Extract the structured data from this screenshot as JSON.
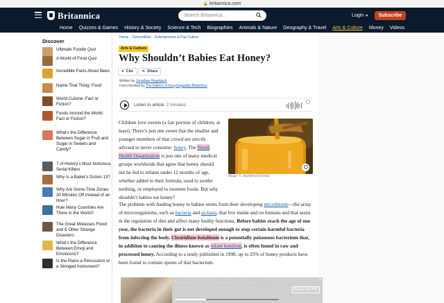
{
  "browser": {
    "url": "britannica.com"
  },
  "header": {
    "logo_text": "Britannica",
    "search_placeholder": "Search Britannica...",
    "login_label": "Login",
    "subscribe_label": "Subscribe"
  },
  "nav": {
    "items": [
      "Home",
      "Quizzes & Games",
      "History & Society",
      "Science & Tech",
      "Biographies",
      "Animals & Nature",
      "Geography & Travel",
      "Arts & Culture",
      "Money",
      "Videos"
    ],
    "active": "Arts & Culture"
  },
  "discover": {
    "title": "Discover",
    "items": [
      {
        "label": "Ultimate Foodie Quiz",
        "thumb": "#c8a06a"
      },
      {
        "label": "A World of Food Quiz",
        "thumb": "#9a6a3a"
      },
      {
        "label": "Incredible Facts About Bees",
        "thumb": "#d9a531"
      },
      {
        "label": "Name That Thing: Food",
        "thumb": "#c98a4e"
      },
      {
        "label": "World Cuisine: Fact or Fiction?",
        "thumb": "#7a4e2c"
      },
      {
        "label": "Foods Around the World: Fact or Fiction?",
        "thumb": "#b05a2a"
      },
      {
        "label": "What's the Difference Between Sugar in Fruit and Sugar in Sweets and Candy?",
        "thumb": "#d87a5a"
      },
      {
        "label": "7 of History's Most Notorious Serial Killers",
        "thumb": "#5a5a5a"
      },
      {
        "label": "Why Is a Baker's Dozen 13?",
        "thumb": "#a86d3c"
      },
      {
        "label": "Why Are Some Time Zones 30 Minutes Off Instead of an Hour?",
        "thumb": "#4a7ab0"
      },
      {
        "label": "How Many Countries Are There in the World?",
        "thumb": "#3f6f9a"
      },
      {
        "label": "The Great Molasses Flood and 6 Other Strange Disasters",
        "thumb": "#6b5a4a"
      },
      {
        "label": "What's the Difference Between Emoji and Emoticons?",
        "thumb": "#e0b84a"
      },
      {
        "label": "Is the Piano a Percussion or a Stringed Instrument?",
        "thumb": "#2f2f2f"
      }
    ]
  },
  "article": {
    "breadcrumb": [
      "Home",
      "Demystified",
      "Entertainment & Pop Culture"
    ],
    "tag": "Arts & Culture",
    "title": "Why Shouldn’t Babies Eat Honey?",
    "cite_label": "Cite",
    "share_label": "Share",
    "written_prefix": "Written by",
    "author": "Jonathan Hogeback",
    "factcheck_prefix": "Fact-checked by",
    "factchecker": "The Editors of Encyclopaedia Britannica",
    "listen_label": "Listen to article",
    "listen_duration": "2 minutes",
    "image_caption": "Image: © chuckbrock/Fotolia",
    "p1": {
      "a": "Children love sweets (a fair portion of children, at least). There’s just one sweet that the smaller and younger members of that crowd are strictly advised to never consume: ",
      "link1": "honey",
      "b": ". The ",
      "link2": "World Health Organization",
      "c": " is just one of many medical groups worldwide that agree that honey should not be fed to infants under 12 months of age, whether added to their formula, used to soothe teething, or employed to sweeten foods. But why shouldn’t babies eat honey?"
    },
    "p2": {
      "a": "The problem with feeding honey to babies stems from their developing ",
      "link1": "microbiome",
      "b": "—the array of microorganisms, such as ",
      "link2": "bacteria",
      "c": " and ",
      "link3": "archaea",
      "d": ", that live inside and on humans and that assist in the regulation of diet and affect many bodily functions. ",
      "bold1": "Before babies reach the age of one year, the bacteria in their gut is not developed enough to stop certain harmful bacteria from infecting the body. ",
      "bi": "Clostridium botulinum",
      "bold2": " is a potentially poisonous bacterium that, in addition to causing the illness known as ",
      "link4": "infant botulism",
      "bold3": ", is often found in raw and processed honey.",
      "e": " According to a study published in 1998, up to 25% of honey products have been found to contain spores of that bacterium."
    }
  },
  "ad": {
    "text": "Maximise your potential as a Senior Care Assistant at Anchor",
    "read_more": "READ MORE",
    "close": "×",
    "progress": 0.3
  }
}
